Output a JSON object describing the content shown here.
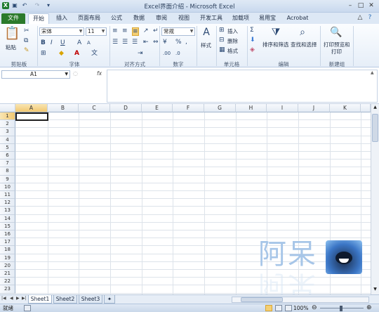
{
  "title_bar": {
    "title": "Excel界面介绍 - Microsoft Excel",
    "qat_icons": [
      "excel-logo-icon",
      "save-icon",
      "undo-icon",
      "redo-icon",
      "customize-icon"
    ]
  },
  "tabs": [
    "文件",
    "开始",
    "插入",
    "页面布局",
    "公式",
    "数据",
    "审阅",
    "视图",
    "开发工具",
    "加载项",
    "易用宝",
    "Acrobat"
  ],
  "ribbon": {
    "clipboard": {
      "paste": "粘贴",
      "label": "剪贴板"
    },
    "font": {
      "name": "宋体",
      "size": "11",
      "label": "字体"
    },
    "alignment": {
      "label": "对齐方式"
    },
    "number": {
      "format": "常规",
      "label": "数字"
    },
    "styles": {
      "styles": "样式"
    },
    "cells": {
      "insert": "插入",
      "delete": "删除",
      "format": "格式",
      "label": "单元格"
    },
    "editing": {
      "sort": "排序和筛选",
      "find": "查找和选择",
      "label": "编辑"
    },
    "new_group": {
      "print": "打印预览和打印",
      "print_line1": "打印预览和",
      "print_line2": "打印",
      "label": "新建组"
    }
  },
  "formula_bar": {
    "name_box": "A1",
    "fx": "fx",
    "content": ""
  },
  "grid": {
    "columns": [
      "A",
      "B",
      "C",
      "D",
      "E",
      "F",
      "G",
      "H",
      "I",
      "J",
      "K"
    ],
    "rows": [
      "1",
      "2",
      "3",
      "4",
      "5",
      "6",
      "7",
      "8",
      "9",
      "10",
      "11",
      "12",
      "13",
      "14",
      "15",
      "16",
      "17",
      "18",
      "19",
      "20",
      "21",
      "22",
      "23"
    ],
    "active_cell": "A1"
  },
  "sheets": [
    "Sheet1",
    "Sheet2",
    "Sheet3"
  ],
  "status": {
    "mode": "就绪",
    "zoom": "100%"
  },
  "watermark": {
    "text": "阿呆"
  },
  "colors": {
    "file_tab": "#2b7a2b",
    "selected_header": "#f1c76f",
    "accent": "#2c4a74"
  }
}
